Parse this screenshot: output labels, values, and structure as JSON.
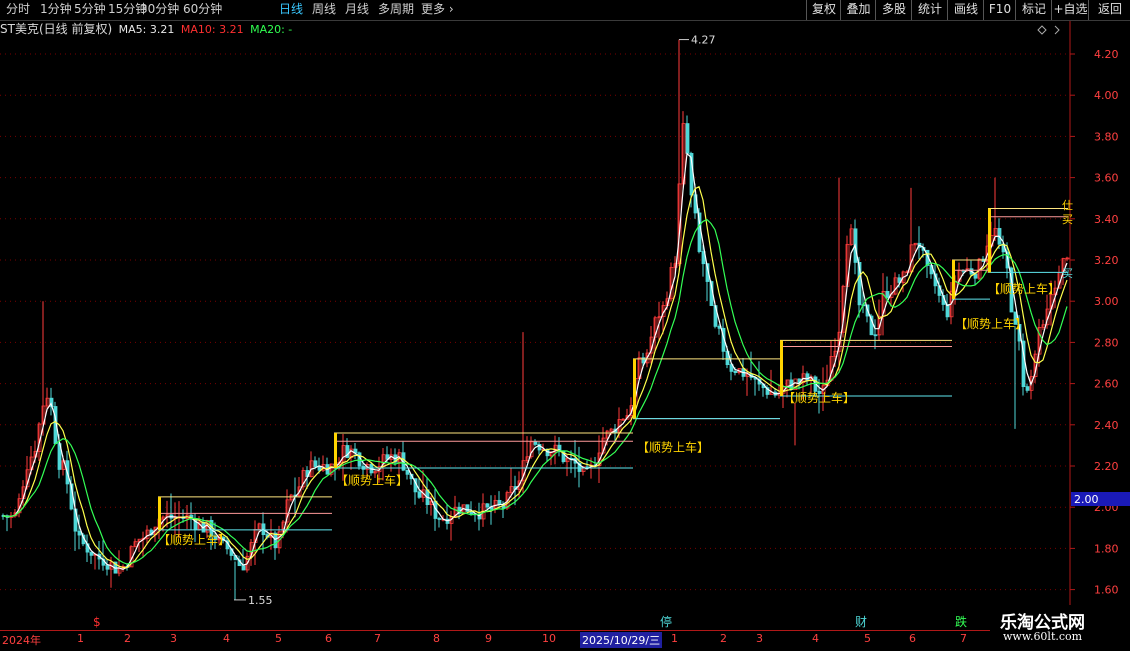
{
  "toolbar": {
    "periods": [
      "分时",
      "1分钟",
      "5分钟",
      "15分钟",
      "30分钟",
      "60分钟",
      "日线",
      "周线",
      "月线",
      "多周期",
      "更多"
    ],
    "active": "日线",
    "right_buttons": [
      "复权",
      "叠加",
      "多股",
      "统计",
      "画线",
      "F10",
      "标记",
      "+自选",
      "返回"
    ]
  },
  "info": {
    "title": "ST美克(日线 前复权)",
    "ma5": "MA5: 3.21",
    "ma10": "MA10: 3.21",
    "ma20": "MA20: -"
  },
  "y_axis": {
    "labels": [
      "4.20",
      "4.00",
      "3.80",
      "3.60",
      "3.40",
      "3.20",
      "3.00",
      "2.80",
      "2.60",
      "2.40",
      "2.20",
      "2.00",
      "1.80",
      "1.60"
    ],
    "current_price": "2.00"
  },
  "x_axis": {
    "labels": [
      "2024年",
      "1",
      "2",
      "3",
      "4",
      "5",
      "6",
      "7",
      "8",
      "9",
      "10",
      "2025/10/29/三",
      "1",
      "2",
      "3",
      "4",
      "5",
      "6",
      "7"
    ]
  },
  "annotations": {
    "high_label": "4.27",
    "low_label": "1.55",
    "signal_text": "【顺势上车】",
    "event_marks": [
      "$",
      "停",
      "财",
      "跌"
    ],
    "side_marks": [
      "仕",
      "买",
      "买"
    ]
  },
  "watermark": {
    "line1": "乐淘公式网",
    "line2": "www.60lt.com"
  },
  "colors": {
    "up": "#ff3b3b",
    "down": "#4fd8d8",
    "ma5": "#ffffff",
    "ma10": "#ffff4d",
    "ma20": "#33ff55",
    "grid": "#7a0000",
    "signal": "#ffd400",
    "axis_text": "#ff4040"
  },
  "chart_data": {
    "type": "candlestick",
    "instrument": "ST美克",
    "ylim": [
      1.55,
      4.3
    ],
    "daily_close_path": [
      [
        "start",
        1.96
      ],
      [
        "2024-peak",
        2.55
      ],
      [
        "2024-low",
        1.72
      ],
      [
        "2024-rebound",
        1.95
      ],
      [
        "2024-Apr-low",
        1.72
      ],
      [
        "2024-May",
        2.18
      ],
      [
        "2024-Jun",
        2.25
      ],
      [
        "2024-Aug",
        2.0
      ],
      [
        "2024-Sep",
        1.98
      ],
      [
        "2024-Oct",
        2.38
      ],
      [
        "2024-Nov",
        2.25
      ],
      [
        "2024-Dec",
        2.5
      ],
      [
        "2025-peak",
        3.85
      ],
      [
        "2025-Jan",
        2.7
      ],
      [
        "2025-Feb",
        2.6
      ],
      [
        "2025-Mar",
        2.5
      ],
      [
        "2025-Apr",
        3.35
      ],
      [
        "2025-May",
        2.9
      ],
      [
        "2025-Jun",
        3.2
      ],
      [
        "2025-Jul",
        3.0
      ],
      [
        "2025-Aug",
        3.35
      ],
      [
        "2025-Sep",
        2.55
      ],
      [
        "end",
        3.25
      ]
    ],
    "extremes": {
      "high": 4.27,
      "low": 1.55
    }
  }
}
